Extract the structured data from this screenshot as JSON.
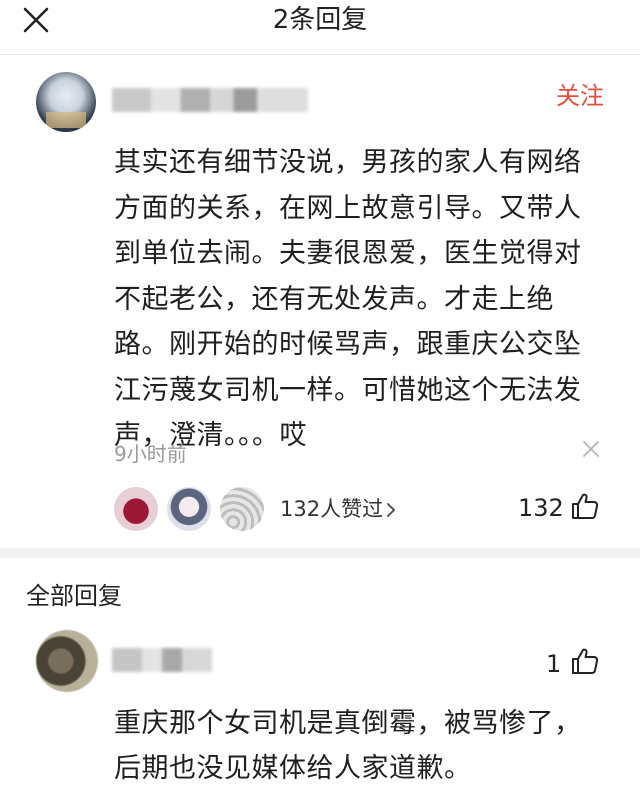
{
  "header": {
    "title": "2条回复",
    "close_icon": "close-icon"
  },
  "main_comment": {
    "follow_label": "关注",
    "lines": [
      "其实还有细节没说，男孩的家人有网络",
      "方面的关系，在网上故意引导。又带人",
      "到单位去闹。夫妻很恩爱，医生觉得对",
      "不起老公，还有无处发声。才走上绝",
      "路。刚开始的时候骂声，跟重庆公交坠",
      "江污蔑女司机一样。可惜她这个无法发",
      "声，澄清。。。哎"
    ],
    "time": "9小时前",
    "likers_text": "132人赞过",
    "like_count": "132",
    "icons": [
      "close-icon",
      "chevron-right-icon",
      "thumbs-up-icon"
    ]
  },
  "replies_section": {
    "title": "全部回复",
    "replies": [
      {
        "like_count": "1",
        "lines": [
          "重庆那个女司机是真倒霉，被骂惨了，",
          "后期也没见媒体给人家道歉。"
        ]
      }
    ]
  },
  "colors": {
    "accent_follow": "#e34d3b",
    "muted_text": "#9a9a9a",
    "section_gap": "#f2f2f2"
  }
}
